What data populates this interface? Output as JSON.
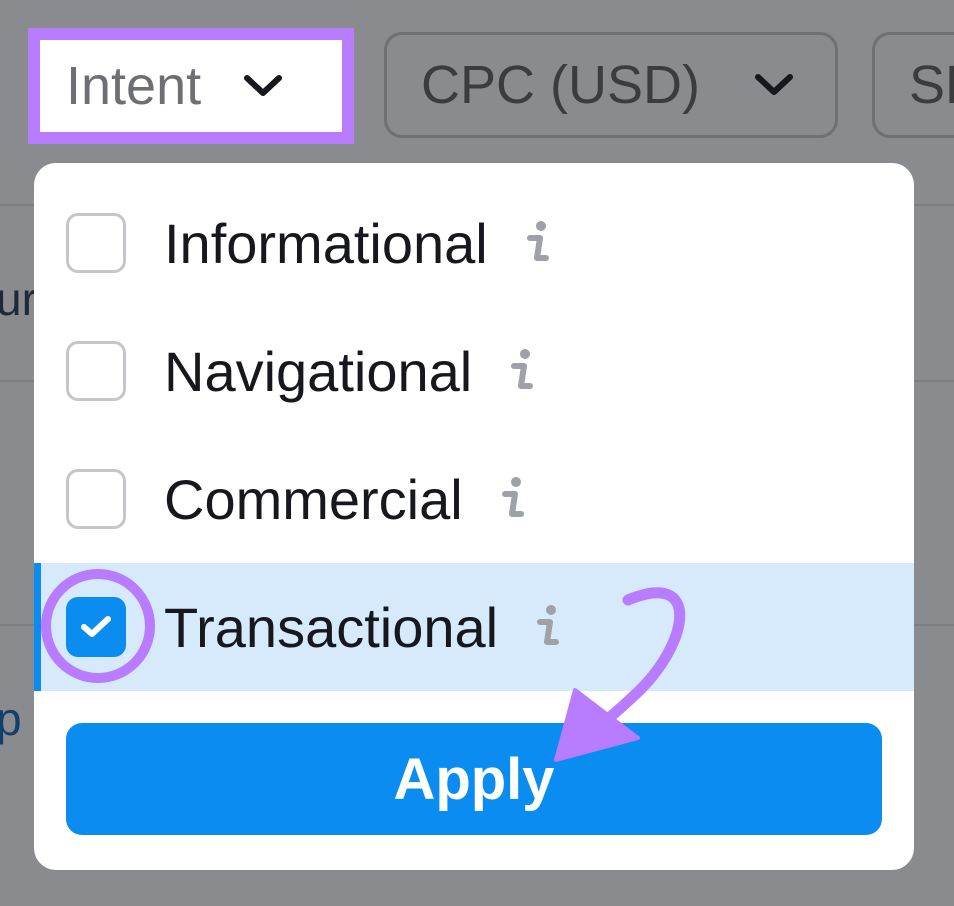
{
  "filters": {
    "intent": {
      "label": "Intent"
    },
    "cpc": {
      "label": "CPC (USD)"
    },
    "next": {
      "label": "SE"
    }
  },
  "background": {
    "fragment_1": "ur",
    "fragment_2": "p"
  },
  "dropdown": {
    "options": [
      {
        "label": "Informational",
        "checked": false,
        "icon": "info-icon"
      },
      {
        "label": "Navigational",
        "checked": false,
        "icon": "info-icon"
      },
      {
        "label": "Commercial",
        "checked": false,
        "icon": "info-icon"
      },
      {
        "label": "Transactional",
        "checked": true,
        "icon": "info-icon"
      }
    ],
    "apply_label": "Apply"
  },
  "colors": {
    "accent_blue": "#0a8cf0",
    "highlight_purple": "#b77cff",
    "selected_row": "#d6eafb",
    "overlay_dim": "#8a8b8e"
  }
}
